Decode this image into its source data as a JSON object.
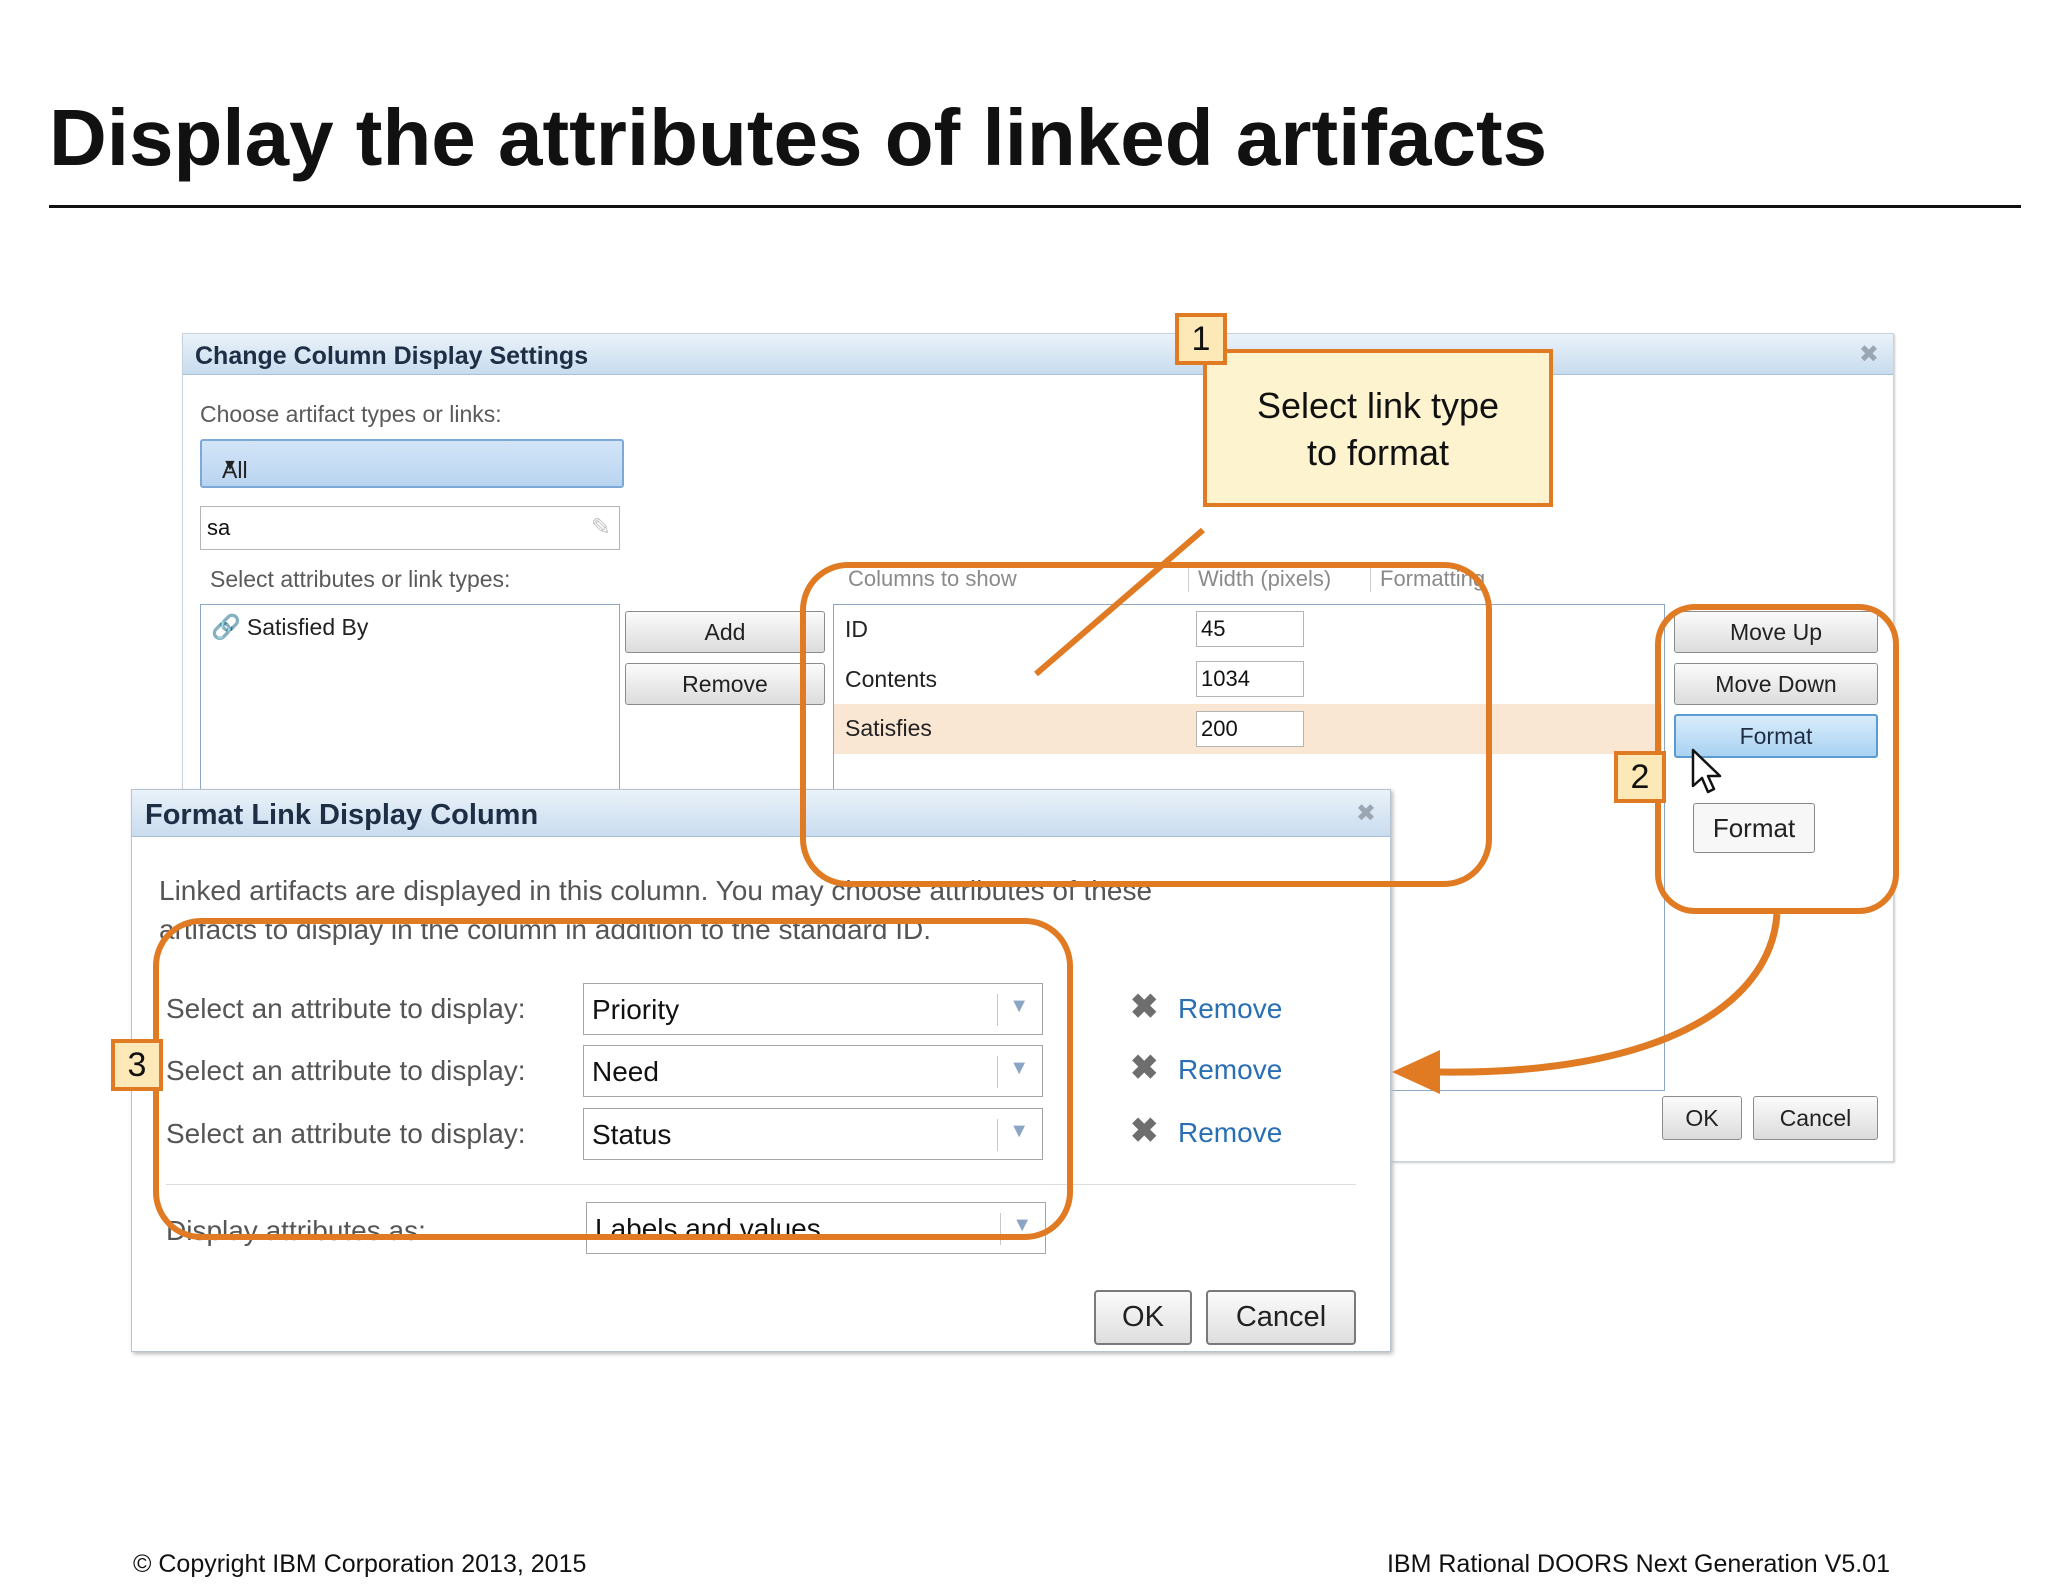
{
  "slide": {
    "title": "Display the attributes of linked artifacts",
    "footer_left": "© Copyright IBM Corporation 2013, 2015",
    "footer_right": "IBM Rational DOORS Next Generation V5.01"
  },
  "column_dialog": {
    "title": "Change Column Display Settings",
    "choose_label": "Choose artifact types or links:",
    "choose_value": "All",
    "filter_value": "sa",
    "select_label": "Select attributes or link types:",
    "available_items": [
      {
        "label": "Satisfied By",
        "icon": "link-icon"
      }
    ],
    "add_label": "Add",
    "remove_label": "Remove",
    "columns_header": {
      "name": "Columns to show",
      "width": "Width (pixels)",
      "format": "Formatting"
    },
    "columns": [
      {
        "name": "ID",
        "width": "45"
      },
      {
        "name": "Contents",
        "width": "1034"
      },
      {
        "name": "Satisfies",
        "width": "200",
        "selected": true
      }
    ],
    "move_up_label": "Move Up",
    "move_down_label": "Move Down",
    "format_label": "Format",
    "format_tooltip": "Format",
    "ok_label": "OK",
    "cancel_label": "Cancel"
  },
  "format_dialog": {
    "title": "Format Link Display Column",
    "description_line1": "Linked artifacts are displayed in this column. You may choose attributes of these",
    "description_line2": "artifacts to display in the column in addition to the standard ID.",
    "attribute_rows": [
      {
        "label": "Select an attribute to display:",
        "value": "Priority",
        "remove": "Remove"
      },
      {
        "label": "Select an attribute to display:",
        "value": "Need",
        "remove": "Remove"
      },
      {
        "label": "Select an attribute to display:",
        "value": "Status",
        "remove": "Remove"
      }
    ],
    "display_as_label": "Display attributes as:",
    "display_as_value": "Labels and values",
    "ok_label": "OK",
    "cancel_label": "Cancel"
  },
  "callouts": {
    "step1": "1",
    "step1_line1": "Select link type",
    "step1_line2": "to format",
    "step2": "2",
    "step3": "3"
  },
  "colors": {
    "accent_orange": "#e07b23",
    "callout_fill": "#fdf4cf",
    "selection_row": "#fae7d3",
    "link_blue": "#2a6fb4"
  }
}
